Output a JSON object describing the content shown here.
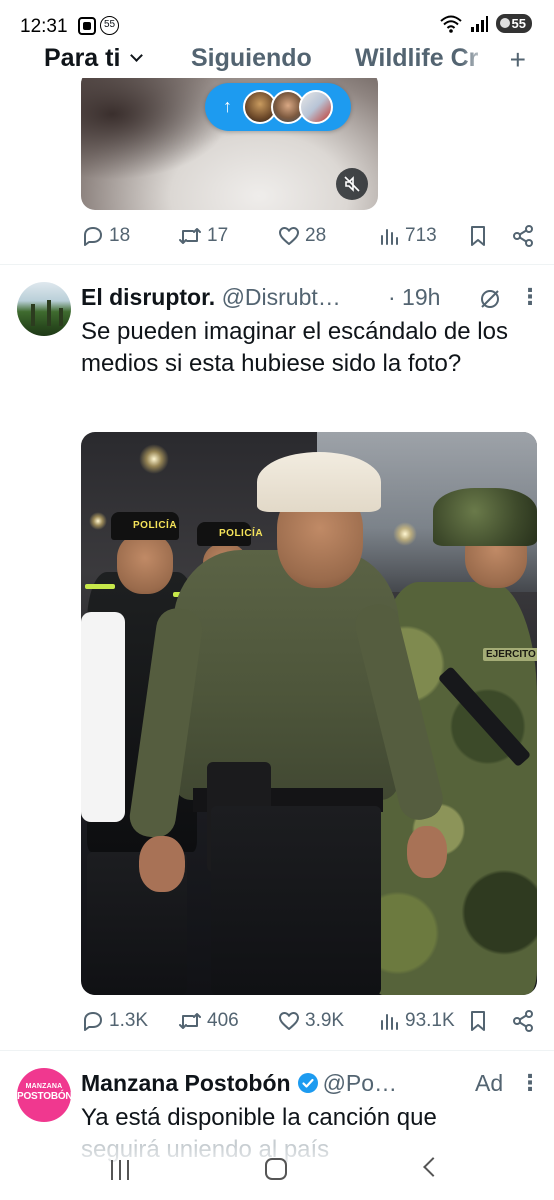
{
  "status_bar": {
    "time": "12:31",
    "notification_count": "55",
    "battery": "55"
  },
  "tabs": [
    {
      "label": "Para ti",
      "active": true
    },
    {
      "label": "Siguiendo",
      "active": false
    },
    {
      "label": "Wildlife Cr",
      "active": false
    }
  ],
  "new_posts_pill": {
    "arrow": "↑"
  },
  "tweet1": {
    "replies": "18",
    "retweets": "17",
    "likes": "28",
    "views": "713"
  },
  "tweet2": {
    "name": "El disruptor.",
    "handle": "@Disrubt…",
    "time": "· 19h",
    "text": "Se pueden imaginar el escándalo de los medios si esta hubiese sido la foto?",
    "photo_labels": {
      "police1": "POLICÍA",
      "police2": "POLICÍA",
      "army": "EJERCITO"
    },
    "replies": "1.3K",
    "retweets": "406",
    "likes": "3.9K",
    "views": "93.1K"
  },
  "tweet3": {
    "avatar_line1": "MANZANA",
    "avatar_line2": "POSTOBÓN",
    "name": "Manzana Postobón",
    "handle": "@Po…",
    "ad_label": "Ad",
    "text_visible": "Ya está disponible la canción que",
    "text_faded": "seguirá uniendo al país"
  },
  "colors": {
    "accent": "#1d9bf0",
    "text_primary": "#0f1419",
    "text_secondary": "#536471",
    "divider": "#eff3f4",
    "ad_avatar": "#f0388f"
  }
}
